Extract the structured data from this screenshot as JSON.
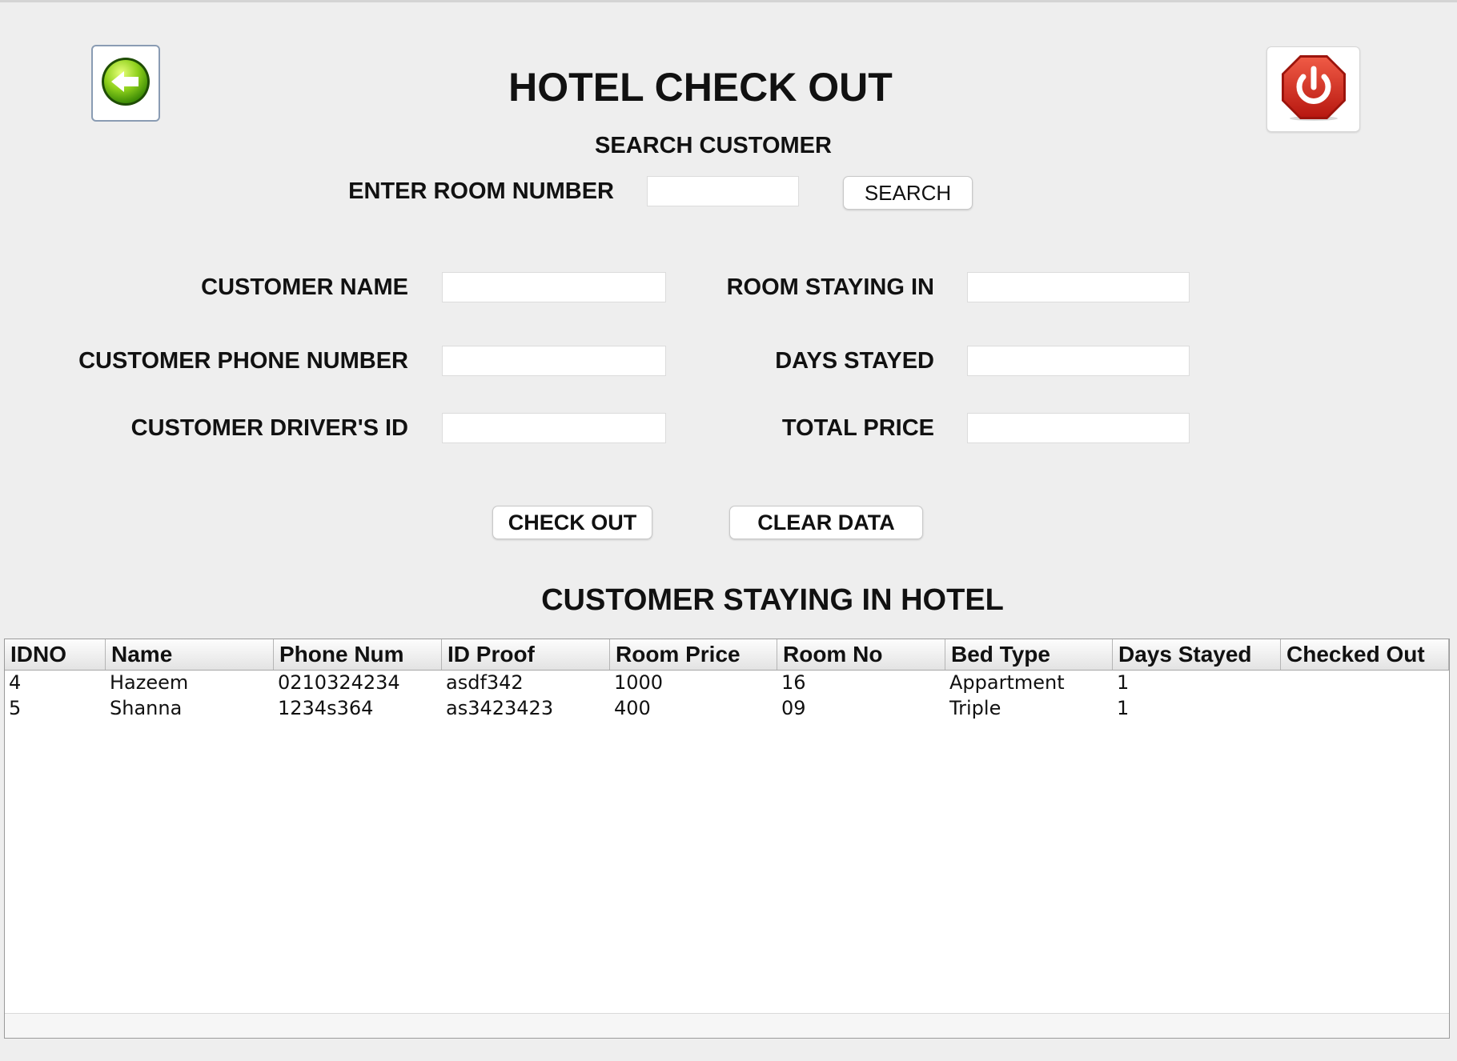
{
  "header": {
    "title": "HOTEL CHECK OUT",
    "back_icon": "arrow-left-icon",
    "power_icon": "power-icon",
    "accent_green": "#7cc61a",
    "accent_red": "#d42a1f"
  },
  "search": {
    "section_title": "SEARCH CUSTOMER",
    "room_number_label": "ENTER ROOM NUMBER",
    "room_number_value": "",
    "search_button": "SEARCH"
  },
  "form": {
    "customer_name_label": "CUSTOMER NAME",
    "customer_name_value": "",
    "phone_label": "CUSTOMER PHONE NUMBER",
    "phone_value": "",
    "drivers_id_label": "CUSTOMER DRIVER'S ID",
    "drivers_id_value": "",
    "room_staying_label": "ROOM STAYING IN",
    "room_staying_value": "",
    "days_stayed_label": "DAYS STAYED",
    "days_stayed_value": "",
    "total_price_label": "TOTAL PRICE",
    "total_price_value": ""
  },
  "actions": {
    "check_out": "CHECK OUT",
    "clear_data": "CLEAR DATA"
  },
  "table": {
    "title": "CUSTOMER STAYING IN HOTEL",
    "columns": [
      "IDNO",
      "Name",
      "Phone Num",
      "ID Proof",
      "Room Price",
      "Room No",
      "Bed Type",
      "Days Stayed",
      "Checked Out"
    ],
    "rows": [
      [
        "4",
        "Hazeem",
        "0210324234",
        "asdf342",
        "1000",
        "16",
        "Appartment",
        "1",
        ""
      ],
      [
        "5",
        "Shanna",
        "1234s364",
        "as3423423",
        "400",
        "09",
        "Triple",
        "1",
        ""
      ]
    ]
  }
}
